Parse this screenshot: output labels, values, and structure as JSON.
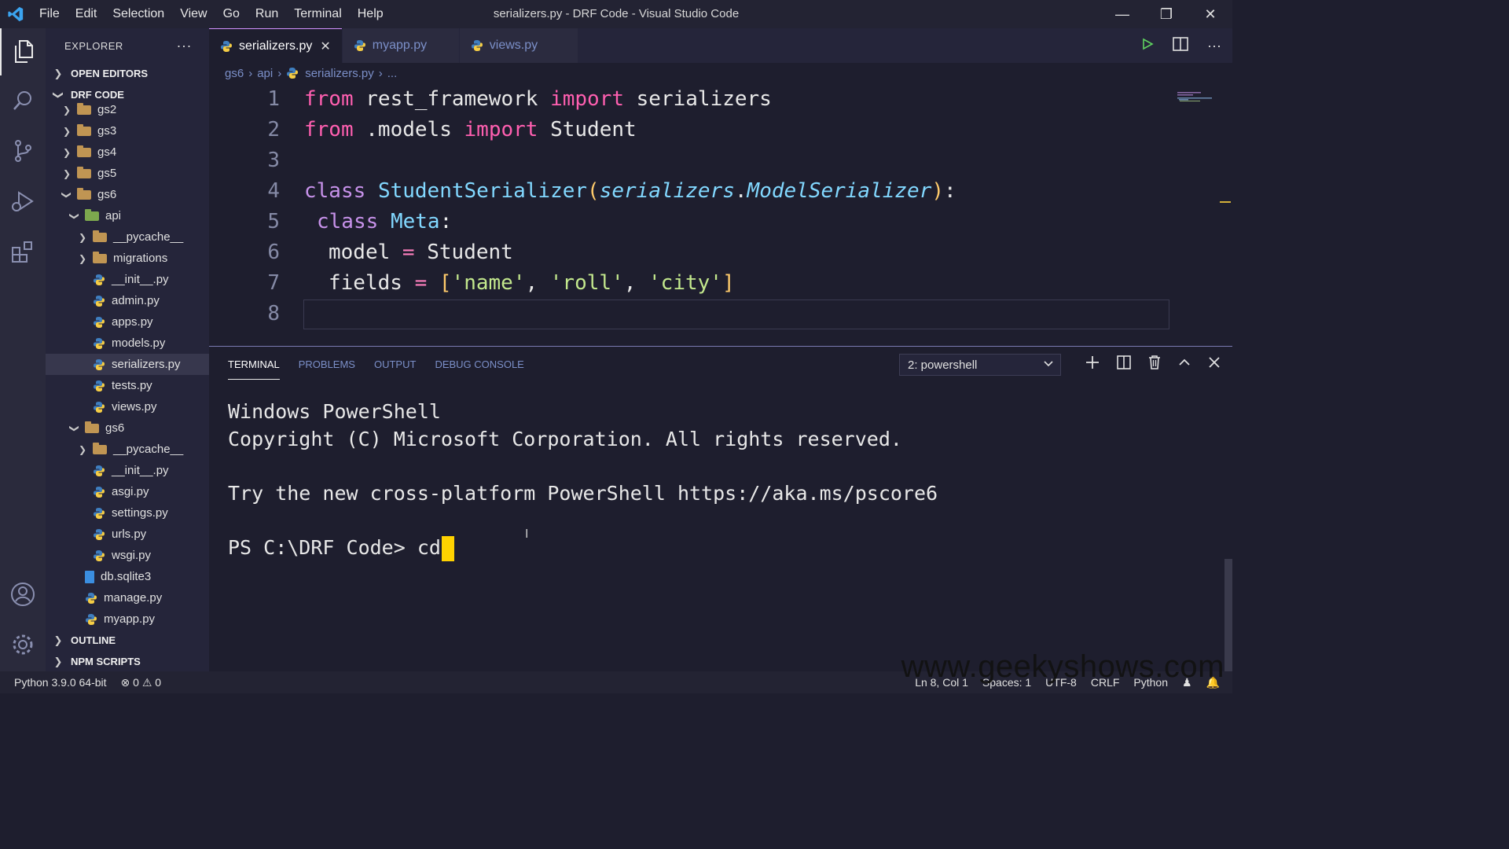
{
  "window": {
    "title": "serializers.py - DRF Code - Visual Studio Code",
    "menu": [
      "File",
      "Edit",
      "Selection",
      "View",
      "Go",
      "Run",
      "Terminal",
      "Help"
    ]
  },
  "sidebar": {
    "header": "EXPLORER",
    "sections": {
      "open_editors": "OPEN EDITORS",
      "workspace": "DRF CODE",
      "outline": "OUTLINE",
      "npm": "NPM SCRIPTS"
    },
    "tree": [
      {
        "label": "gs2",
        "kind": "folder"
      },
      {
        "label": "gs3",
        "kind": "folder"
      },
      {
        "label": "gs4",
        "kind": "folder"
      },
      {
        "label": "gs5",
        "kind": "folder"
      },
      {
        "label": "gs6",
        "kind": "folder"
      },
      {
        "label": "api",
        "kind": "folder"
      },
      {
        "label": "__pycache__",
        "kind": "folder"
      },
      {
        "label": "migrations",
        "kind": "folder"
      },
      {
        "label": "__init__.py",
        "kind": "py"
      },
      {
        "label": "admin.py",
        "kind": "py"
      },
      {
        "label": "apps.py",
        "kind": "py"
      },
      {
        "label": "models.py",
        "kind": "py"
      },
      {
        "label": "serializers.py",
        "kind": "py"
      },
      {
        "label": "tests.py",
        "kind": "py"
      },
      {
        "label": "views.py",
        "kind": "py"
      },
      {
        "label": "gs6",
        "kind": "folder"
      },
      {
        "label": "__pycache__",
        "kind": "folder"
      },
      {
        "label": "__init__.py",
        "kind": "py"
      },
      {
        "label": "asgi.py",
        "kind": "py"
      },
      {
        "label": "settings.py",
        "kind": "py"
      },
      {
        "label": "urls.py",
        "kind": "py"
      },
      {
        "label": "wsgi.py",
        "kind": "py"
      },
      {
        "label": "db.sqlite3",
        "kind": "db"
      },
      {
        "label": "manage.py",
        "kind": "py"
      },
      {
        "label": "myapp.py",
        "kind": "py"
      }
    ]
  },
  "tabs": [
    {
      "label": "serializers.py",
      "active": true
    },
    {
      "label": "myapp.py",
      "active": false
    },
    {
      "label": "views.py",
      "active": false
    }
  ],
  "breadcrumb": [
    "gs6",
    "api",
    "serializers.py",
    "..."
  ],
  "editor": {
    "line_numbers": [
      "1",
      "2",
      "3",
      "4",
      "5",
      "6",
      "7",
      "8"
    ],
    "tokens": {
      "l1": [
        "from",
        " rest_framework ",
        "import",
        " serializers"
      ],
      "l2": [
        "from",
        " .models ",
        "import",
        " Student"
      ],
      "l4": [
        "class",
        " ",
        "StudentSerializer",
        "(",
        "serializers",
        ".",
        "ModelSerializer",
        ")",
        ":"
      ],
      "l5": [
        "class",
        " ",
        "Meta",
        ":"
      ],
      "l6": [
        "model",
        " = ",
        "Student"
      ],
      "l7": [
        "fields",
        " = ",
        "[",
        "'name'",
        ", ",
        "'roll'",
        ", ",
        "'city'",
        "]"
      ]
    }
  },
  "panel": {
    "tabs": [
      "TERMINAL",
      "PROBLEMS",
      "OUTPUT",
      "DEBUG CONSOLE"
    ],
    "terminal_select": "2: powershell",
    "terminal_lines": [
      "Windows PowerShell",
      "Copyright (C) Microsoft Corporation. All rights reserved.",
      "",
      "Try the new cross-platform PowerShell https://aka.ms/pscore6",
      ""
    ],
    "prompt": "PS C:\\DRF Code> ",
    "command": "cd"
  },
  "status": {
    "python": "Python 3.9.0 64-bit",
    "errors": "0",
    "warnings": "0",
    "position": "Ln 8, Col 1",
    "spaces": "Spaces: 1",
    "encoding": "UTF-8",
    "eol": "CRLF",
    "language": "Python"
  },
  "watermark": "www.geekyshows.com",
  "colors": {
    "accent": "#d291ff",
    "keyword": "#c792ea",
    "class": "#82d8ff",
    "string": "#c3e88d",
    "cursor": "#ffd200"
  }
}
